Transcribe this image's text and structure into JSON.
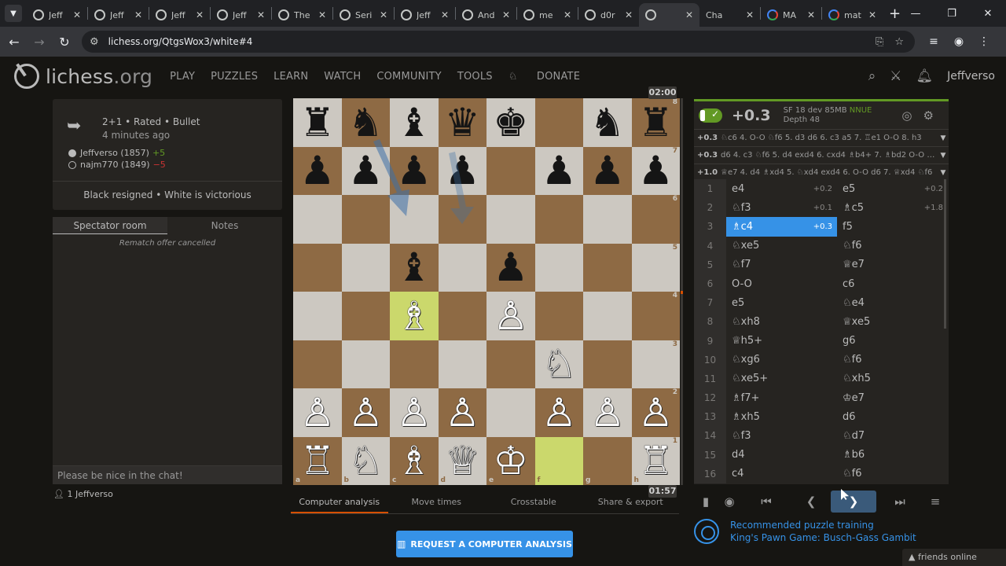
{
  "browser": {
    "tabs": [
      {
        "title": "Jeff",
        "icon": "lichess"
      },
      {
        "title": "Jeff",
        "icon": "lichess"
      },
      {
        "title": "Jeff",
        "icon": "lichess"
      },
      {
        "title": "Jeff",
        "icon": "lichess"
      },
      {
        "title": "The",
        "icon": "lichess"
      },
      {
        "title": "Seri",
        "icon": "lichess"
      },
      {
        "title": "Jeff",
        "icon": "lichess"
      },
      {
        "title": "And",
        "icon": "lichess"
      },
      {
        "title": "me",
        "icon": "lichess"
      },
      {
        "title": "d0r",
        "icon": "lichess"
      },
      {
        "title": "",
        "icon": "lichess",
        "active": true
      },
      {
        "title": "Cha",
        "icon": "chatgpt"
      },
      {
        "title": "MA",
        "icon": "google"
      },
      {
        "title": "mat",
        "icon": "google"
      }
    ],
    "url": "lichess.org/QtgsWox3/white#4"
  },
  "header": {
    "logo": "lichess",
    "logo_suffix": ".org",
    "nav": [
      "PLAY",
      "PUZZLES",
      "LEARN",
      "WATCH",
      "COMMUNITY",
      "TOOLS"
    ],
    "donate": "DONATE",
    "username": "Jeffverso"
  },
  "game": {
    "type": "2+1 • Rated • Bullet",
    "time_ago": "4 minutes ago",
    "white": {
      "name": "Jeffverso (1857)",
      "diff": "+5"
    },
    "black": {
      "name": "najm770 (1849)",
      "diff": "−5"
    },
    "result": "Black resigned • White is victorious"
  },
  "chat": {
    "tab_room": "Spectator room",
    "tab_notes": "Notes",
    "message": "Rematch offer cancelled",
    "placeholder": "Please be nice in the chat!",
    "spectator_count": "1",
    "spectator_name": "Jeffverso"
  },
  "board": {
    "rows": [
      [
        "♜",
        "♞",
        "♝",
        "♛",
        "♚",
        "",
        "♞",
        "♜"
      ],
      [
        "♟",
        "♟",
        "♟",
        "♟",
        "",
        "♟",
        "♟",
        "♟"
      ],
      [
        "",
        "",
        "",
        "",
        "",
        "",
        "",
        ""
      ],
      [
        "",
        "",
        "♝",
        "",
        "♟",
        "",
        "",
        ""
      ],
      [
        "",
        "",
        "♗",
        "",
        "♙",
        "",
        "",
        ""
      ],
      [
        "",
        "",
        "",
        "",
        "",
        "♘",
        "",
        ""
      ],
      [
        "♙",
        "♙",
        "♙",
        "♙",
        "",
        "♙",
        "♙",
        "♙"
      ],
      [
        "♖",
        "♘",
        "♗",
        "♕",
        "♔",
        "",
        "",
        "♖"
      ]
    ],
    "colors": [
      [
        "b",
        "b",
        "b",
        "b",
        "b",
        "",
        "b",
        "b"
      ],
      [
        "b",
        "b",
        "b",
        "b",
        "",
        "b",
        "b",
        "b"
      ],
      [
        "",
        "",
        "",
        "",
        "",
        "",
        "",
        ""
      ],
      [
        "",
        "",
        "b",
        "",
        "b",
        "",
        "",
        ""
      ],
      [
        "",
        "",
        "w",
        "",
        "w",
        "",
        "",
        ""
      ],
      [
        "",
        "",
        "",
        "",
        "",
        "w",
        "",
        ""
      ],
      [
        "w",
        "w",
        "w",
        "w",
        "",
        "w",
        "w",
        "w"
      ],
      [
        "w",
        "w",
        "w",
        "w",
        "w",
        "",
        "",
        "w"
      ]
    ],
    "highlight": [
      [
        4,
        2
      ],
      [
        7,
        5
      ]
    ],
    "files": [
      "a",
      "b",
      "c",
      "d",
      "e",
      "f",
      "g",
      "h"
    ],
    "ranks": [
      "8",
      "7",
      "6",
      "5",
      "4",
      "3",
      "2",
      "1"
    ]
  },
  "clocks": {
    "top": "02:00",
    "bottom": "01:57"
  },
  "under_tabs": [
    "Computer analysis",
    "Move times",
    "Crosstable",
    "Share & export"
  ],
  "request_button": "REQUEST A COMPUTER ANALYSIS",
  "engine": {
    "eval": "+0.3",
    "name": "SF 18 dev 85MB",
    "nnue": "NNUE",
    "depth": "Depth 48",
    "pvs": [
      {
        "score": "+0.3",
        "line": "♘c6 4. O-O ♘f6 5. d3 d6 6. c3 a5 7. ♖e1 O-O 8. h3"
      },
      {
        "score": "+0.3",
        "line": "d6 4. c3 ♘f6 5. d4 exd4 6. cxd4 ♗b4+ 7. ♗bd2 O-O 8. O-O"
      },
      {
        "score": "+1.0",
        "line": "♕e7 4. d4 ♗xd4 5. ♘xd4 exd4 6. O-O d6 7. ♕xd4 ♘f6"
      }
    ]
  },
  "moves": [
    {
      "n": "1",
      "w": "e4",
      "we": "+0.2",
      "b": "e5",
      "be": "+0.2"
    },
    {
      "n": "2",
      "w": "♘f3",
      "we": "+0.1",
      "b": "♗c5",
      "be": "+1.8"
    },
    {
      "n": "3",
      "w": "♗c4",
      "we": "+0.3",
      "b": "f5",
      "be": "",
      "current": true
    },
    {
      "n": "4",
      "w": "♘xe5",
      "we": "",
      "b": "♘f6",
      "be": ""
    },
    {
      "n": "5",
      "w": "♘f7",
      "we": "",
      "b": "♕e7",
      "be": ""
    },
    {
      "n": "6",
      "w": "O-O",
      "we": "",
      "b": "c6",
      "be": ""
    },
    {
      "n": "7",
      "w": "e5",
      "we": "",
      "b": "♘e4",
      "be": ""
    },
    {
      "n": "8",
      "w": "♘xh8",
      "we": "",
      "b": "♕xe5",
      "be": ""
    },
    {
      "n": "9",
      "w": "♕h5+",
      "we": "",
      "b": "g6",
      "be": ""
    },
    {
      "n": "10",
      "w": "♘xg6",
      "we": "",
      "b": "♘f6",
      "be": ""
    },
    {
      "n": "11",
      "w": "♘xe5+",
      "we": "",
      "b": "♘xh5",
      "be": ""
    },
    {
      "n": "12",
      "w": "♗f7+",
      "we": "",
      "b": "♔e7",
      "be": ""
    },
    {
      "n": "13",
      "w": "♗xh5",
      "we": "",
      "b": "d6",
      "be": ""
    },
    {
      "n": "14",
      "w": "♘f3",
      "we": "",
      "b": "♘d7",
      "be": ""
    },
    {
      "n": "15",
      "w": "d4",
      "we": "",
      "b": "♗b6",
      "be": ""
    },
    {
      "n": "16",
      "w": "c4",
      "we": "",
      "b": "♘f6",
      "be": ""
    }
  ],
  "puzzle": {
    "title": "Recommended puzzle training",
    "name": "King's Pawn Game: Busch-Gass Gambit"
  },
  "friends": "friends online"
}
